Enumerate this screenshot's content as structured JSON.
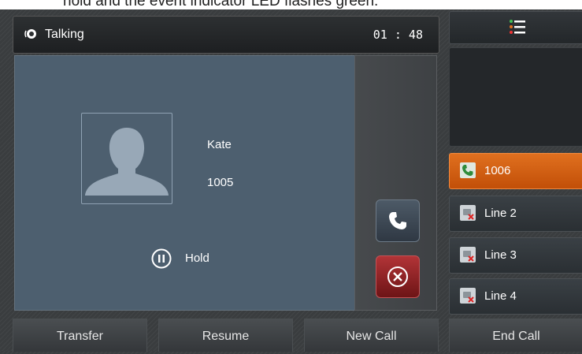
{
  "caption": {
    "text": "hold and the event indicator LED flashes green."
  },
  "status": {
    "label": "Talking",
    "timer": "01 : 48",
    "icon": "speaker-icon"
  },
  "contact": {
    "name": "Kate",
    "number": "1005",
    "avatar": "person-silhouette-icon"
  },
  "hold": {
    "label": "Hold",
    "icon": "pause-icon"
  },
  "actions": {
    "answer_icon": "handset-icon",
    "reject_icon": "close-circle-icon"
  },
  "menu": {
    "icon": "menu-icon"
  },
  "lines": [
    {
      "label": "1006",
      "icon": "handset-icon",
      "active": true
    },
    {
      "label": "Line 2",
      "icon": "line-unregistered-icon",
      "active": false
    },
    {
      "label": "Line 3",
      "icon": "line-unregistered-icon",
      "active": false
    },
    {
      "label": "Line 4",
      "icon": "line-unregistered-icon",
      "active": false
    }
  ],
  "softkeys": [
    "Transfer",
    "Resume",
    "New Call",
    "End Call"
  ],
  "colors": {
    "accent": "#e0701f",
    "main_panel": "#4d5f6f",
    "reject": "#b23437"
  }
}
